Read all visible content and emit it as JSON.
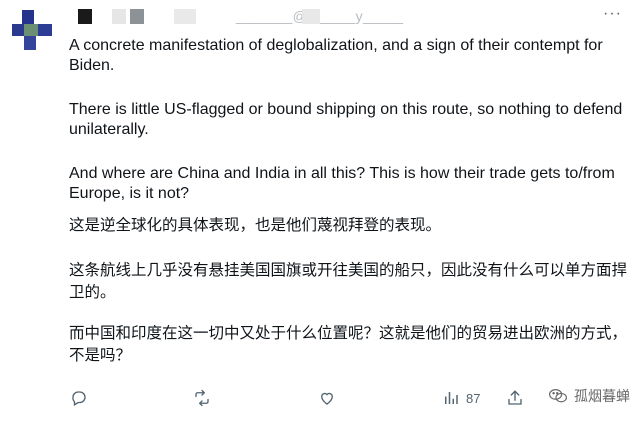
{
  "header": {
    "handle": "_______@______y_____",
    "more_label": "···"
  },
  "tweet": {
    "en_p1": "A concrete manifestation of deglobalization, and a sign of their contempt for Biden.",
    "en_p2": "There is little US-flagged or bound shipping on this route, so nothing to defend unilaterally.",
    "en_p3": "And where are China and India in all this? This is how their trade gets to/from Europe, is it not?",
    "zh_p1": "这是逆全球化的具体表现，也是他们蔑视拜登的表现。",
    "zh_p2": "这条航线上几乎没有悬挂美国国旗或开往美国的船只，因此没有什么可以单方面捍卫的。",
    "zh_p3": "而中国和印度在这一切中又处于什么位置呢？这就是他们的贸易进出欧洲的方式，不是吗？"
  },
  "actions": {
    "reply_icon": "reply-icon",
    "retweet_icon": "retweet-icon",
    "like_icon": "like-icon",
    "views_icon": "views-icon",
    "views_count": "87",
    "bookmark_icon": "bookmark-icon",
    "share_icon": "share-icon"
  },
  "watermark": {
    "text": "孤烟暮蝉",
    "icon": "wechat-icon"
  },
  "colors": {
    "text": "#0f1419",
    "muted": "#536471",
    "avatar_navy": "#1f2f7a",
    "avatar_green": "#6b8f72"
  }
}
